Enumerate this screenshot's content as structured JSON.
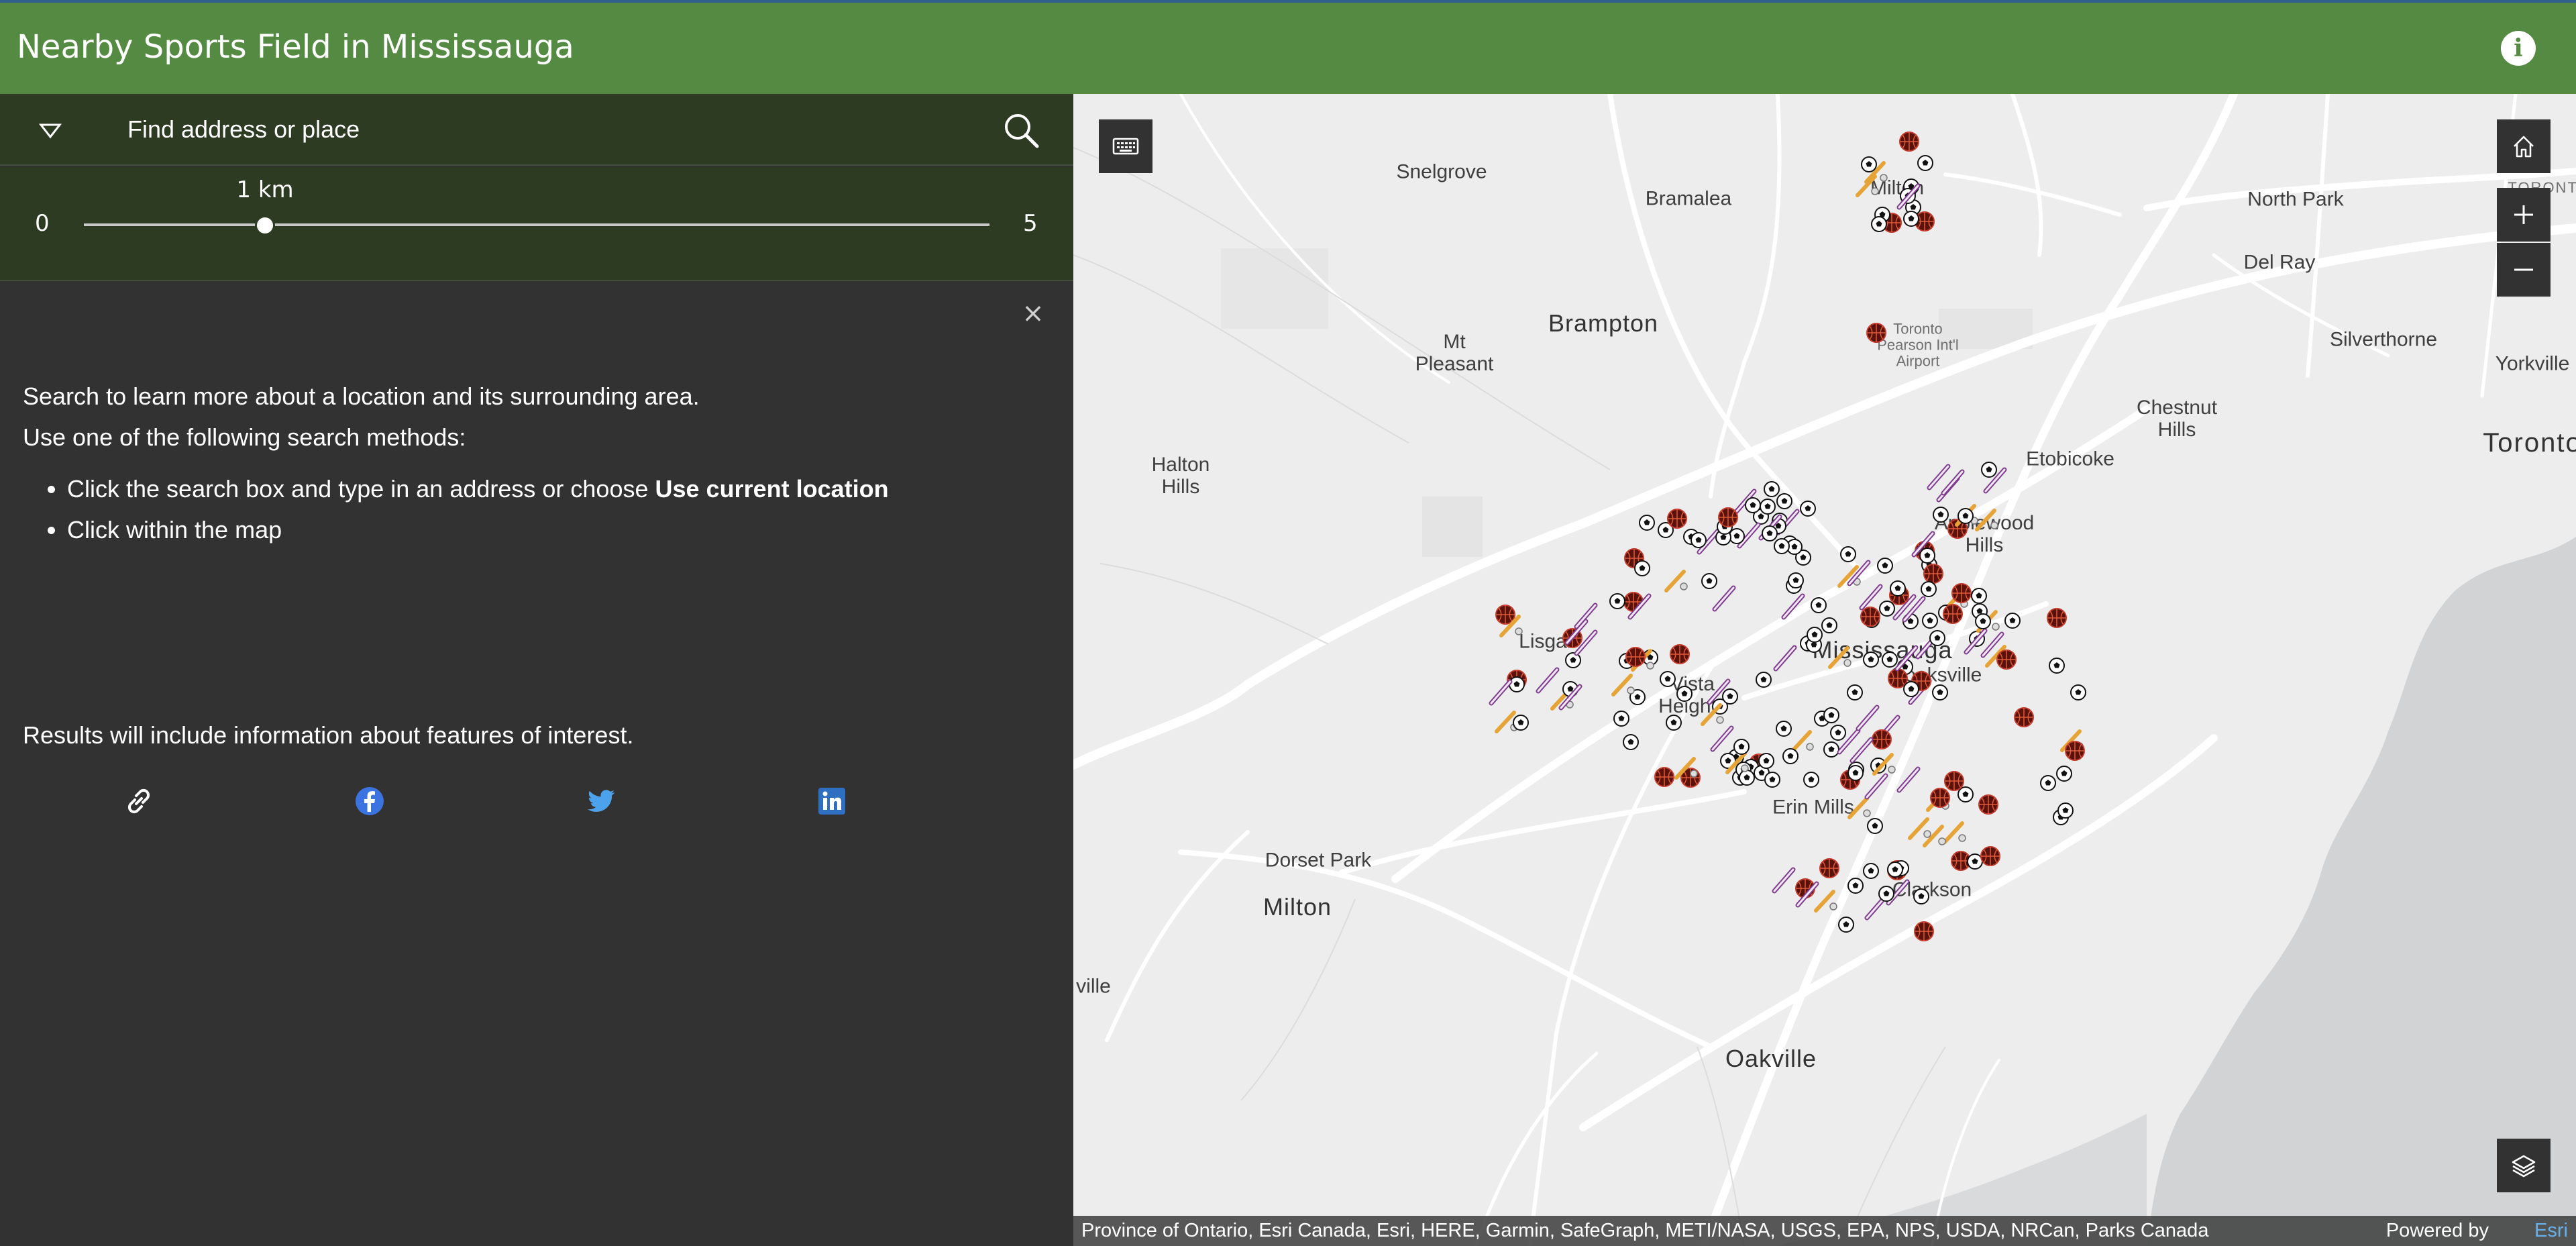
{
  "header": {
    "title": "Nearby Sports Field in Mississauga",
    "info_icon": "info-icon"
  },
  "search": {
    "placeholder": "Find address or place",
    "value": ""
  },
  "slider": {
    "min_label": "0",
    "max_label": "5",
    "value_label": "1 km",
    "min": 0,
    "max": 5,
    "value": 1
  },
  "panel": {
    "line1": "Search to learn more about a location and its surrounding area.",
    "line2": "Use one of the following search methods:",
    "bullet1_prefix": "Click the search box and type in an address or choose ",
    "bullet1_bold": "Use current location",
    "bullet2": "Click within the map",
    "results_note": "Results will include information about features of interest."
  },
  "share": [
    "link-icon",
    "facebook-icon",
    "twitter-icon",
    "linkedin-icon"
  ],
  "map_labels": {
    "snelgrove": "Snelgrove",
    "bramalea": "Bramalea",
    "brampton": "Brampton",
    "mt_pleasant": "Mt\nPleasant",
    "halton_hills": "Halton\nHills",
    "milton_n": "Milton",
    "airport": "Toronto\nPearson Int'l\nAirport",
    "north_park": "North Park",
    "del_ray": "Del Ray",
    "silverthorne": "Silverthorne",
    "yorkville": "Yorkville",
    "toronto": "Toronto",
    "toronto_small": "TORONTO",
    "chestnut_hills": "Chestnut\nHills",
    "etobicoke": "Etobicoke",
    "applewood_hills": "Applewood\nHills",
    "lisgar": "Lisgar",
    "mississauga": "Mississauga",
    "cooksville": "Cooksville",
    "vista_heights": "Vista\nHeights",
    "erin_mills": "Erin Mills",
    "dorset_park": "Dorset Park",
    "milton": "Milton",
    "clarkson": "Clarkson",
    "oakville": "Oakville",
    "ville": "ville"
  },
  "map_controls": [
    "keyboard-icon",
    "home-icon",
    "zoom-in-icon",
    "zoom-out-icon",
    "layers-icon"
  ],
  "attribution": {
    "text": "Province of Ontario, Esri Canada, Esri, HERE, Garmin, SafeGraph, METI/NASA, USGS, EPA, NPS, USDA, NRCan, Parks Canada",
    "powered_by": "Powered by",
    "esri": "Esri"
  },
  "colors": {
    "header": "#548a42",
    "search_bar": "#2c3b22",
    "panel": "#323232",
    "link": "#6ab0e8"
  }
}
